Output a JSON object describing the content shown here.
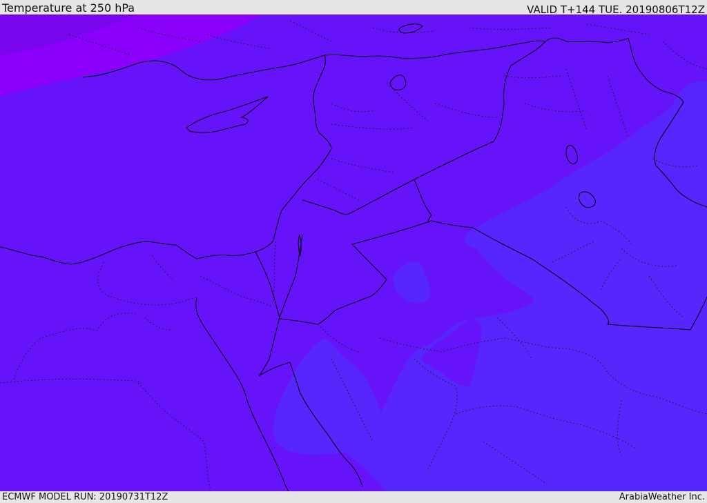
{
  "header": {
    "title": "Temperature at 250 hPa",
    "valid_time": "VALID T+144 TUE. 20190806T12Z"
  },
  "footer": {
    "model_run": "ECMWF MODEL RUN: 20190731T12Z",
    "credit": "ArabiaWeather Inc."
  },
  "colors": {
    "background": "#6713fa",
    "warm_band_dark": "#7a06ee",
    "warm_band": "#8a00fb",
    "cool_band": "#5626fd",
    "coastline": "#000000",
    "border_dotted": "#222244"
  }
}
